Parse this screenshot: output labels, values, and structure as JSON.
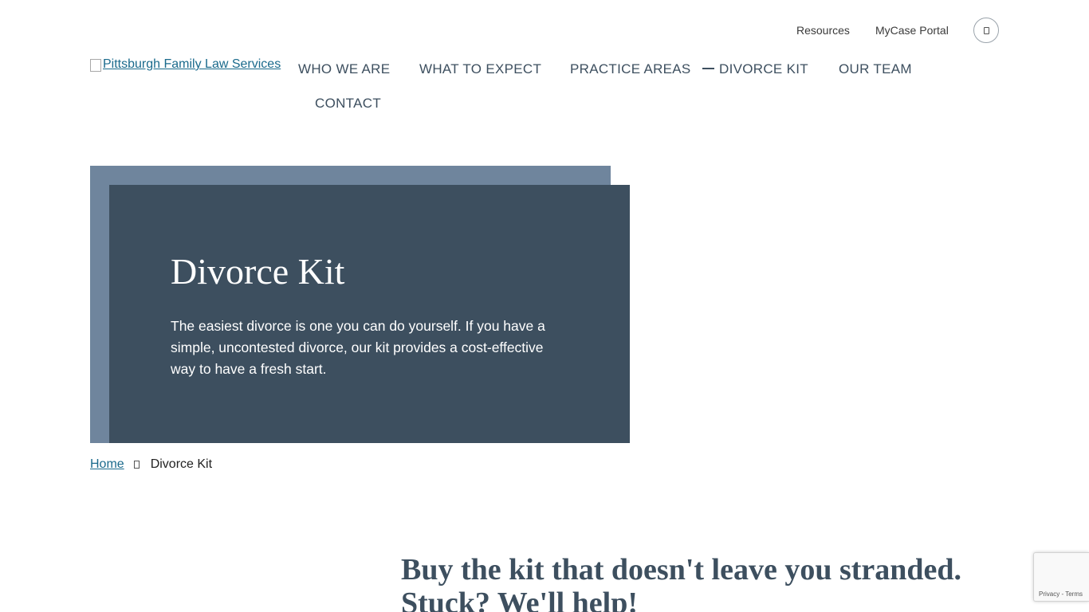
{
  "utility_nav": {
    "resources": "Resources",
    "portal": "MyCase Portal",
    "search_icon": "search-icon"
  },
  "logo": {
    "alt_text": "Pittsburgh Family Law Services"
  },
  "main_nav": {
    "items": [
      {
        "label": "WHO WE ARE"
      },
      {
        "label": "WHAT TO EXPECT"
      },
      {
        "label": "PRACTICE AREAS"
      },
      {
        "label": "DIVORCE KIT",
        "active": true
      },
      {
        "label": "OUR TEAM"
      },
      {
        "label": "CONTACT"
      }
    ]
  },
  "hero": {
    "title": "Divorce Kit",
    "text": "The easiest divorce is one you can do yourself. If you have a simple, uncontested divorce, our kit provides a cost-effective way to have a fresh start."
  },
  "breadcrumb": {
    "home": "Home",
    "current": "Divorce Kit",
    "separator_icon": "chevron-right-icon"
  },
  "promo": {
    "heading": "Buy the kit that doesn't leave you stranded. Stuck? We'll help!"
  },
  "recaptcha": {
    "privacy": "Privacy",
    "separator": " - ",
    "terms": "Terms"
  },
  "colors": {
    "hero_dark": "#3d4f5f",
    "hero_light": "#6f859d",
    "link": "#1a6a8c",
    "text": "#3d4f5f"
  }
}
